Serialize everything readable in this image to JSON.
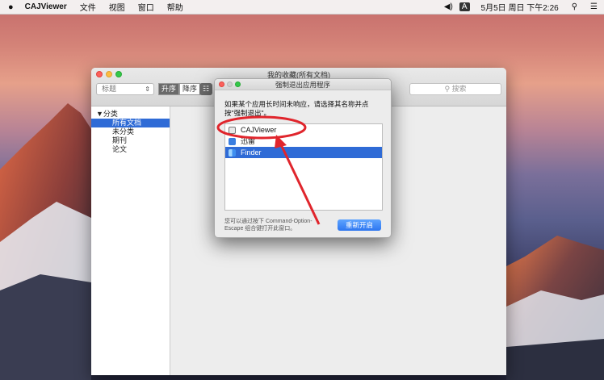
{
  "menubar": {
    "app_name": "CAJViewer",
    "menus": [
      "文件",
      "视图",
      "窗口",
      "帮助"
    ],
    "datetime": "5月5日 周日 下午2:26",
    "input_indicator": "A"
  },
  "main_window": {
    "title": "我的收藏(所有文档)",
    "sort_field": "标题",
    "sort_asc": "升序",
    "sort_desc": "降序",
    "search_placeholder": "搜索",
    "sidebar": {
      "group": "▼分类",
      "items": [
        "所有文档",
        "未分类",
        "期刊",
        "论文"
      ],
      "selected": "所有文档"
    }
  },
  "force_quit_dialog": {
    "title": "强制退出应用程序",
    "message": "如果某个应用长时间未响应，请选择其名称并点按\"强制退出\"。",
    "apps": [
      {
        "name": "CAJViewer",
        "icon": "cajviewer-icon"
      },
      {
        "name": "迅雷",
        "icon": "thunder-icon"
      },
      {
        "name": "Finder",
        "icon": "finder-icon",
        "selected": true
      }
    ],
    "hint": "您可以通过按下 Command-Option-Escape 组合键打开此窗口。",
    "button_label": "重新开启"
  },
  "annotation": {
    "color": "#e0252c",
    "highlighted_item": "CAJViewer"
  }
}
